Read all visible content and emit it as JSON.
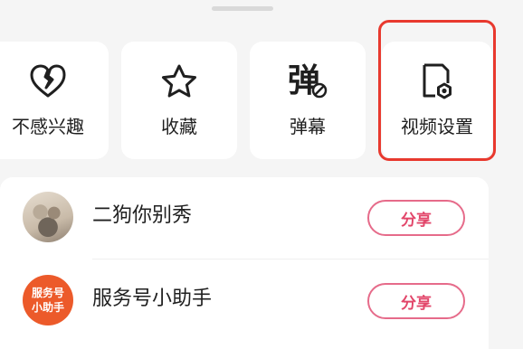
{
  "actions": [
    {
      "label": "不感兴趣",
      "icon": "broken-heart-icon"
    },
    {
      "label": "收藏",
      "icon": "star-icon"
    },
    {
      "label": "弹幕",
      "icon": "danmaku-icon",
      "glyph": "弹"
    },
    {
      "label": "视频设置",
      "icon": "video-settings-icon"
    }
  ],
  "share_list": [
    {
      "name": "二狗你别秀",
      "button": "分享"
    },
    {
      "name": "服务号小助手",
      "button": "分享",
      "avatar_lines": [
        "服务号",
        "小助手"
      ]
    }
  ],
  "colors": {
    "accent": "#e2466a",
    "highlight": "#e8392e",
    "service_avatar": "#ec5a2a"
  }
}
